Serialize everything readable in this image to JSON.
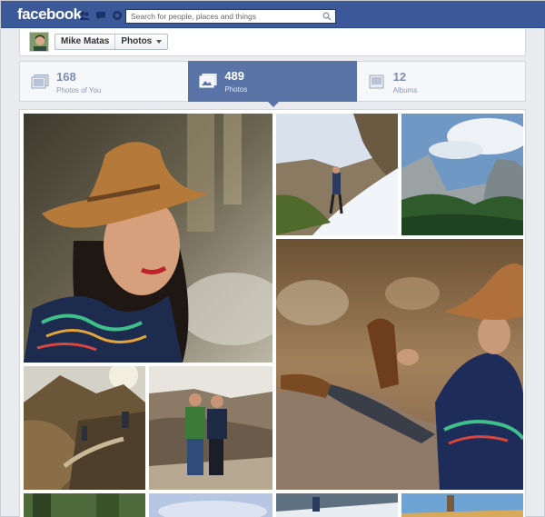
{
  "header": {
    "logo": "facebook",
    "search_placeholder": "Search for people, places and things",
    "icons": [
      "friend-requests-icon",
      "messages-icon",
      "notifications-icon",
      "search-icon"
    ],
    "brand_color": "#3b5998"
  },
  "profile": {
    "name": "Mike Matas",
    "section": "Photos"
  },
  "tabs": [
    {
      "count": "168",
      "label": "Photos of You",
      "icon": "photos-of-you-icon",
      "active": false
    },
    {
      "count": "489",
      "label": "Photos",
      "icon": "photos-icon",
      "active": true
    },
    {
      "count": "12",
      "label": "Albums",
      "icon": "albums-icon",
      "active": false
    }
  ],
  "photos": [
    {
      "name": "photo-woman-hat-portrait"
    },
    {
      "name": "photo-hiker-snowy-ridge"
    },
    {
      "name": "photo-yosemite-valley"
    },
    {
      "name": "photo-sitting-on-rock"
    },
    {
      "name": "photo-cliff-trail-hikers"
    },
    {
      "name": "photo-couple-mountain"
    },
    {
      "name": "photo-forest-bottom-1"
    },
    {
      "name": "photo-sky-bottom-2"
    },
    {
      "name": "photo-snow-bottom-3"
    },
    {
      "name": "photo-desert-bottom-4"
    }
  ]
}
